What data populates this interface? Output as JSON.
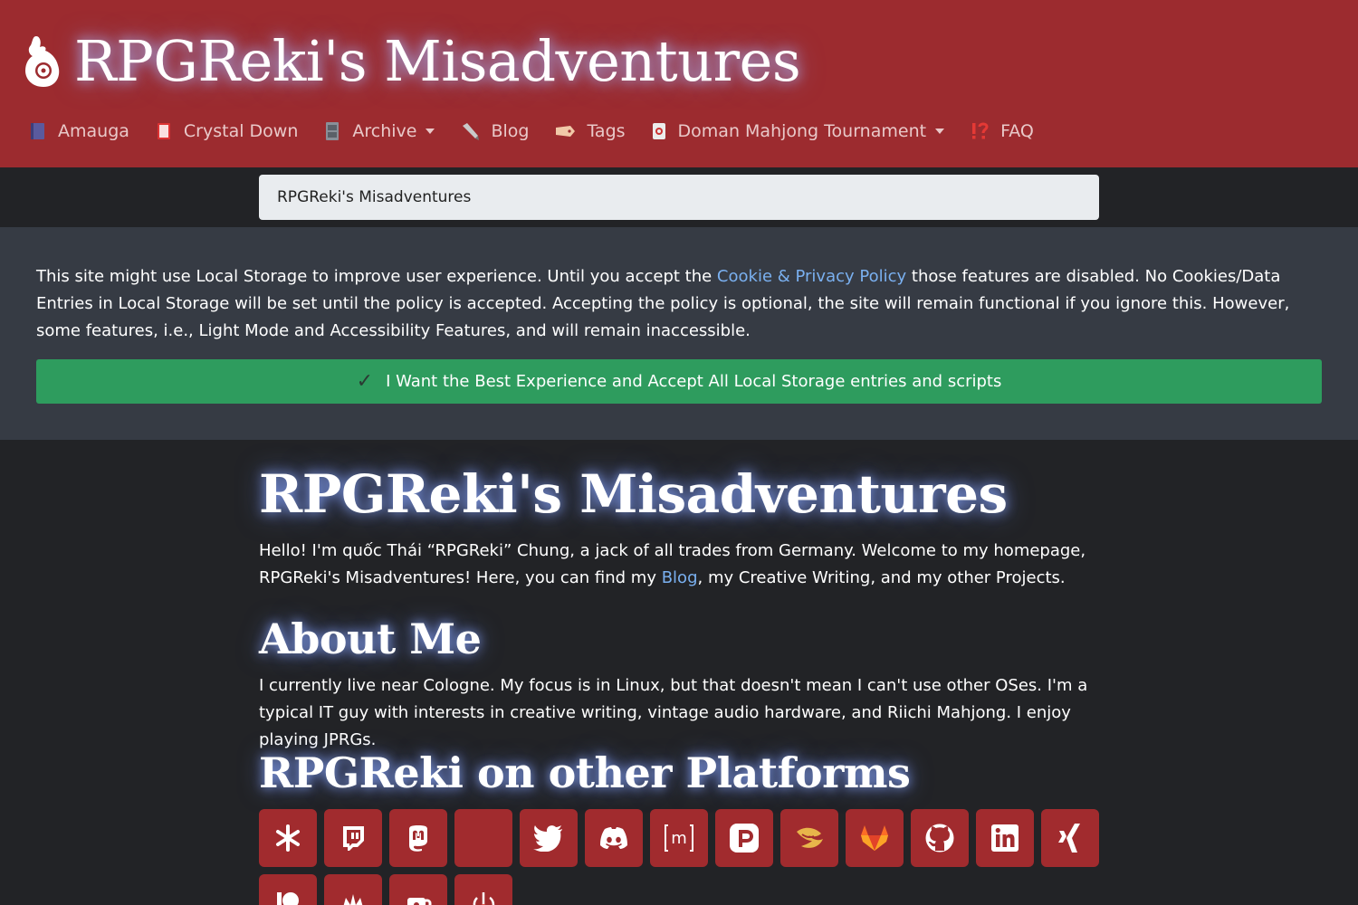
{
  "header": {
    "site_title": "RPGReki's Misadventures",
    "nav": [
      {
        "label": "Amauga",
        "icon": "book-icon",
        "dropdown": false
      },
      {
        "label": "Crystal Down",
        "icon": "red-book-icon",
        "dropdown": false
      },
      {
        "label": "Archive",
        "icon": "file-cabinet-icon",
        "dropdown": true
      },
      {
        "label": "Blog",
        "icon": "pen-icon",
        "dropdown": false
      },
      {
        "label": "Tags",
        "icon": "tag-icon",
        "dropdown": false
      },
      {
        "label": "Doman Mahjong Tournament",
        "icon": "mahjong-tile-icon",
        "dropdown": true
      },
      {
        "label": "FAQ",
        "icon": "exclamation-question-icon",
        "dropdown": false
      }
    ]
  },
  "search": {
    "value": "RPGReki's Misadventures"
  },
  "cookie_banner": {
    "text_before": "This site might use Local Storage to improve user experience. Until you accept the ",
    "link": "Cookie & Privacy Policy",
    "text_after": " those features are disabled. No Cookies/Data Entries in Local Storage will be set until the policy is accepted. Accepting the policy is optional, the site will remain functional if you ignore this. However, some features, i.e., Light Mode and Accessibility Features, and will remain inaccessible.",
    "accept_button": "I Want the Best Experience and Accept All Local Storage entries and scripts"
  },
  "main": {
    "title": "RPGReki's Misadventures",
    "intro_before": "Hello! I'm quốc Thái “RPGReki” Chung, a jack of all trades from Germany.  Welcome to my homepage, RPGReki's Misadventures!  Here, you can find my ",
    "intro_link": "Blog",
    "intro_after": ", my Creative Writing, and my other Projects.",
    "about_heading": "About Me",
    "about_text": "I currently live near Cologne.  My focus is in Linux, but that doesn't mean I can't use other OSes.  I'm a typical IT guy with interests in creative writing, vintage audio hardware, and Riichi Mahjong.  I enjoy playing JPRGs.",
    "platforms_heading": "RPGReki on other Platforms",
    "platforms": [
      "linktree-icon",
      "twitch-icon",
      "mastodon-icon",
      "blank-icon",
      "twitter-icon",
      "discord-icon",
      "matrix-icon",
      "pixelfed-icon",
      "lemmy-icon",
      "gitlab-icon",
      "github-icon",
      "linkedin-icon",
      "xing-icon",
      "patreon-icon",
      "kofi-icon",
      "ko-fi-cup-icon",
      "power-icon"
    ]
  },
  "colors": {
    "header_bg": "#9c2b2f",
    "page_bg": "#222326",
    "banner_bg": "#363b44",
    "accept_green": "#2e9c5e",
    "link_blue": "#7ab0f0",
    "platform_button": "#a12b2e"
  }
}
